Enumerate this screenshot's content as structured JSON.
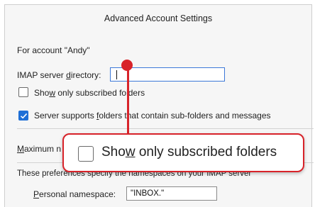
{
  "dialog": {
    "title": "Advanced Account Settings",
    "account_line": "For account \"Andy\""
  },
  "imap": {
    "label_before": "IMAP server ",
    "label_accel": "d",
    "label_after": "irectory:",
    "value": ""
  },
  "subscribed": {
    "label_before": "Sho",
    "label_accel": "w",
    "label_after": " only subscribed folders",
    "checked": false
  },
  "subfolders": {
    "label_before": "Server supports ",
    "label_accel": "f",
    "label_after": "olders that contain sub-folders and messages",
    "checked": true
  },
  "max": {
    "label_accel": "M",
    "label_after": "aximum n"
  },
  "namespace_section": {
    "description": "These preferences specify the namespaces on your IMAP server",
    "personal_label_accel": "P",
    "personal_label_after": "ersonal namespace:",
    "personal_value": "\"INBOX.\""
  },
  "callout": {
    "label_before": "Sho",
    "label_accel": "w",
    "label_after": " only subscribed folders"
  },
  "colors": {
    "accent": "#1f6fd6",
    "callout_red": "#d8232a"
  }
}
